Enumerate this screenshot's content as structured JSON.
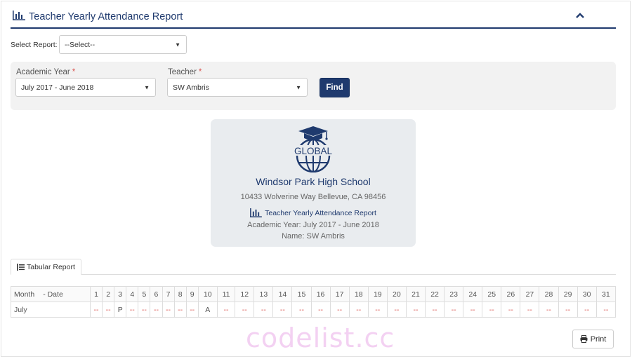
{
  "header": {
    "title": "Teacher Yearly Attendance Report",
    "collapse_icon": "chevron-up-icon"
  },
  "select_report": {
    "label": "Select Report:",
    "value": "--Select--"
  },
  "filters": {
    "academic_year": {
      "label": "Academic Year",
      "required": "*",
      "value": "July 2017 - June 2018"
    },
    "teacher": {
      "label": "Teacher",
      "required": "*",
      "value": "SW Ambris"
    },
    "find_label": "Find"
  },
  "card": {
    "logo_text": "GLOBAL",
    "school_name": "Windsor Park High School",
    "address": "10433 Wolverine Way Bellevue, CA 98456",
    "report_title": "Teacher Yearly Attendance Report",
    "academic_year_line": "Academic Year: July 2017 - June 2018",
    "name_line": "Name: SW Ambris"
  },
  "tab": {
    "label": "Tabular Report"
  },
  "table": {
    "month_header": "Month",
    "date_header": "- Date",
    "days": [
      "1",
      "2",
      "3",
      "4",
      "5",
      "6",
      "7",
      "8",
      "9",
      "10",
      "11",
      "12",
      "13",
      "14",
      "15",
      "16",
      "17",
      "18",
      "19",
      "20",
      "21",
      "22",
      "23",
      "24",
      "25",
      "26",
      "27",
      "28",
      "29",
      "30",
      "31"
    ],
    "rows": [
      {
        "month": "July",
        "values": [
          "--",
          "--",
          "P",
          "--",
          "--",
          "--",
          "--",
          "--",
          "--",
          "A",
          "--",
          "--",
          "--",
          "--",
          "--",
          "--",
          "--",
          "--",
          "--",
          "--",
          "--",
          "--",
          "--",
          "--",
          "--",
          "--",
          "--",
          "--",
          "--",
          "--",
          "--"
        ]
      }
    ]
  },
  "print_label": "Print",
  "watermark": "codelist.cc",
  "colors": {
    "brand": "#1f3a6e",
    "absent_dash": "#d9534f",
    "panel": "#f2f2f2"
  }
}
